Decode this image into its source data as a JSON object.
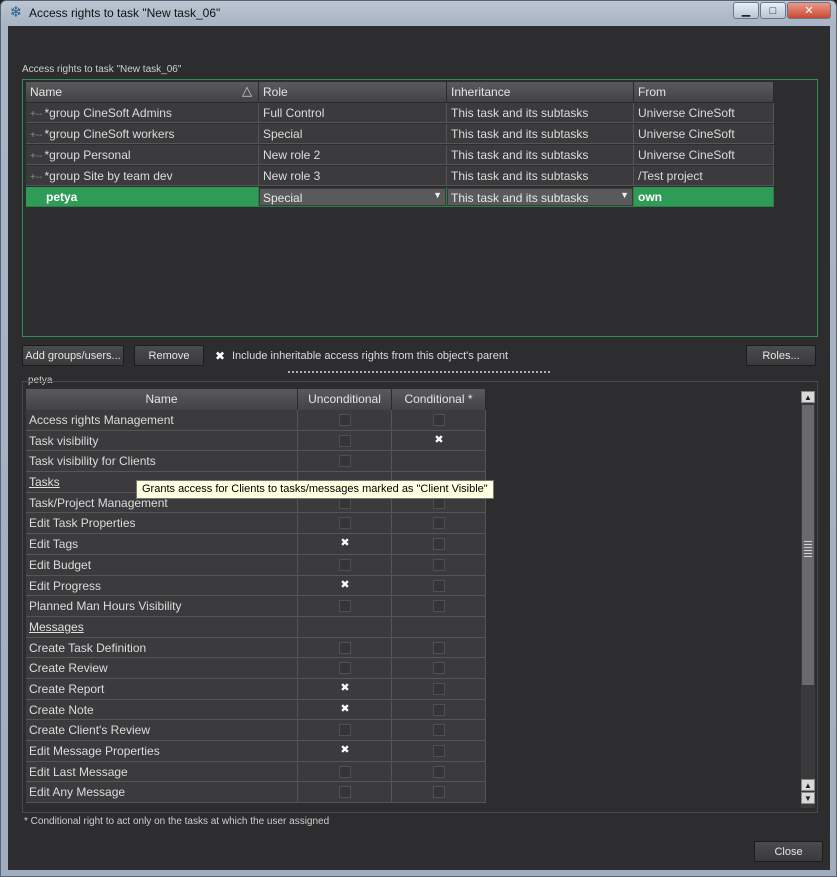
{
  "window": {
    "title": "Access rights to task \"New task_06\"",
    "min_glyph": "▁",
    "max_glyph": "□",
    "close_glyph": "✕"
  },
  "top_group": {
    "label": "Access rights to task \"New task_06\"",
    "columns": [
      "Name",
      "Role",
      "Inheritance",
      "From"
    ],
    "rows": [
      {
        "name": "*group CineSoft Admins",
        "role": "Full Control",
        "inheritance": "This task and its subtasks",
        "from": "Universe CineSoft"
      },
      {
        "name": "*group CineSoft workers",
        "role": "Special",
        "inheritance": "This task and its subtasks",
        "from": "Universe CineSoft"
      },
      {
        "name": "*group Personal",
        "role": "New role 2",
        "inheritance": "This task and its subtasks",
        "from": "Universe CineSoft"
      },
      {
        "name": "*group Site by team dev",
        "role": "New role 3",
        "inheritance": "This task and its subtasks",
        "from": "/Test project"
      }
    ],
    "selected": {
      "name": "petya",
      "role": "Special",
      "inheritance": "This task and its subtasks",
      "from": "own"
    }
  },
  "buttons": {
    "add": "Add groups/users...",
    "remove": "Remove",
    "include_label": "Include inheritable access rights from this object's parent",
    "include_checked": true,
    "roles": "Roles...",
    "close": "Close"
  },
  "bottom_group": {
    "label": "petya",
    "columns": [
      "Name",
      "Unconditional",
      "Conditional *"
    ],
    "rows": [
      {
        "name": "Access rights Management",
        "unconditional": false,
        "conditional": false,
        "section": false
      },
      {
        "name": "Task visibility",
        "unconditional": false,
        "conditional": true,
        "section": false
      },
      {
        "name": "Task visibility for Clients",
        "unconditional": false,
        "conditional": null,
        "section": false
      },
      {
        "name": "Tasks",
        "unconditional": null,
        "conditional": null,
        "section": true
      },
      {
        "name": "Task/Project Management",
        "unconditional": false,
        "conditional": false,
        "section": false
      },
      {
        "name": "Edit Task Properties",
        "unconditional": false,
        "conditional": false,
        "section": false
      },
      {
        "name": "Edit Tags",
        "unconditional": true,
        "conditional": false,
        "section": false
      },
      {
        "name": "Edit Budget",
        "unconditional": false,
        "conditional": false,
        "section": false
      },
      {
        "name": "Edit Progress",
        "unconditional": true,
        "conditional": false,
        "section": false
      },
      {
        "name": "Planned Man Hours Visibility",
        "unconditional": false,
        "conditional": false,
        "section": false
      },
      {
        "name": "Messages",
        "unconditional": null,
        "conditional": null,
        "section": true
      },
      {
        "name": "Create Task Definition",
        "unconditional": false,
        "conditional": false,
        "section": false
      },
      {
        "name": "Create Review",
        "unconditional": false,
        "conditional": false,
        "section": false
      },
      {
        "name": "Create Report",
        "unconditional": true,
        "conditional": false,
        "section": false
      },
      {
        "name": "Create Note",
        "unconditional": true,
        "conditional": false,
        "section": false
      },
      {
        "name": "Create Client's Review",
        "unconditional": false,
        "conditional": false,
        "section": false
      },
      {
        "name": "Edit Message Properties",
        "unconditional": true,
        "conditional": false,
        "section": false
      },
      {
        "name": "Edit Last Message",
        "unconditional": false,
        "conditional": false,
        "section": false
      },
      {
        "name": "Edit Any Message",
        "unconditional": false,
        "conditional": false,
        "section": false
      }
    ],
    "tooltip": "Grants access for Clients to tasks/messages marked as \"Client Visible\""
  },
  "footnote": "* Conditional right to act only on the tasks at which the user assigned",
  "icons": {
    "app": "snowflake-icon",
    "check": "✖",
    "sort": "△",
    "dropdown": "▼",
    "scroll_up": "▲",
    "scroll_down": "▼"
  }
}
